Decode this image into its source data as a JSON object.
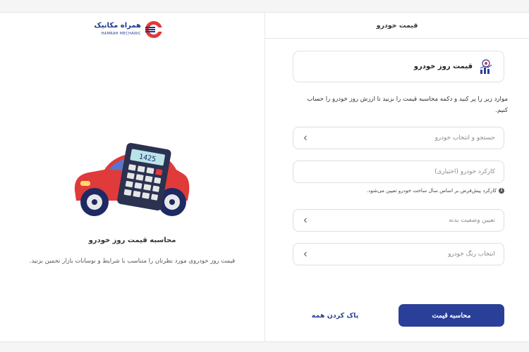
{
  "header": {
    "panel_title": "قیمت خودرو"
  },
  "logo": {
    "text_fa": "همراه مکانیک",
    "text_en": "HAMRAH MECHANIC"
  },
  "left": {
    "heading": "محاسبه قیمت روز خودرو",
    "description": "قیمت روز خودروی مورد نظرتان را متناسب با شرایط و نوسانات بازار تخمین بزنید.",
    "calculator_display": "1425"
  },
  "form": {
    "title": "قیمت روز خودرو",
    "instruction": "موارد زیر را پر کنید و دکمه محاسبه قیمت را بزنید تا ارزش روز خودرو را حساب کنیم.",
    "fields": {
      "car_search": "جستجو و انتخاب خودرو",
      "mileage": "کارکرد خودرو (اختیاری)",
      "body_status": "تعیین وضعیت بدنه",
      "color": "انتخاب رنگ خودرو"
    },
    "mileage_hint": "کارکرد پیش‌فرض بر اساس سال ساخت خودرو تعیین می‌شود.",
    "submit_label": "محاسبه قیمت",
    "clear_label": "پاک کردن همه"
  },
  "colors": {
    "primary": "#2a3f98",
    "car_red": "#e13a3a",
    "border": "#dedede"
  },
  "icons": [
    "logo-icon",
    "price-chart-icon",
    "chevron-left-icon",
    "info-icon",
    "car-calculator-illustration"
  ]
}
